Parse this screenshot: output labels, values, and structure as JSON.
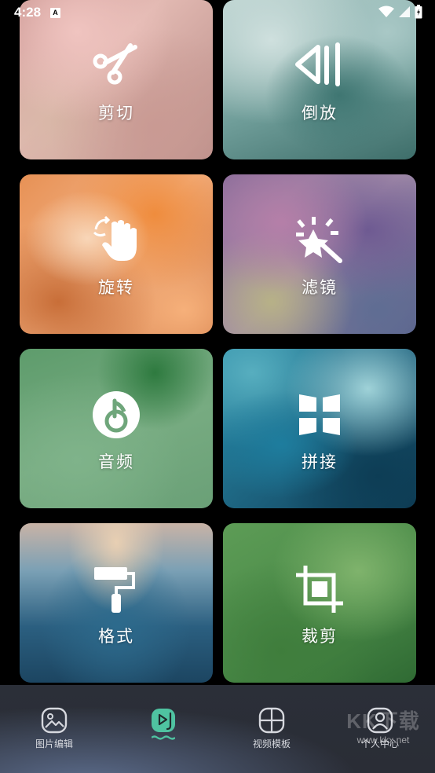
{
  "status_bar": {
    "time": "4:28",
    "notification_badge": "A"
  },
  "tools": [
    {
      "label": "剪切",
      "icon": "scissors-icon"
    },
    {
      "label": "倒放",
      "icon": "reverse-play-icon"
    },
    {
      "label": "旋转",
      "icon": "rotate-hand-icon"
    },
    {
      "label": "滤镜",
      "icon": "magic-wand-icon"
    },
    {
      "label": "音频",
      "icon": "music-disc-icon"
    },
    {
      "label": "拼接",
      "icon": "grid-splice-icon"
    },
    {
      "label": "格式",
      "icon": "paint-roller-icon"
    },
    {
      "label": "裁剪",
      "icon": "crop-icon"
    }
  ],
  "bottom_nav": {
    "items": [
      {
        "label": "图片编辑",
        "icon": "image-icon"
      },
      {
        "label": "",
        "icon": "video-edit-icon",
        "active": true
      },
      {
        "label": "视频模板",
        "icon": "template-grid-icon"
      },
      {
        "label": "个人中心",
        "icon": "user-icon"
      }
    ]
  },
  "watermark": {
    "brand": "KK下载",
    "url": "www.kkx.net"
  },
  "colors": {
    "nav_bg": "#2a2d36",
    "active_nav_tint": "#4fc3a1"
  }
}
